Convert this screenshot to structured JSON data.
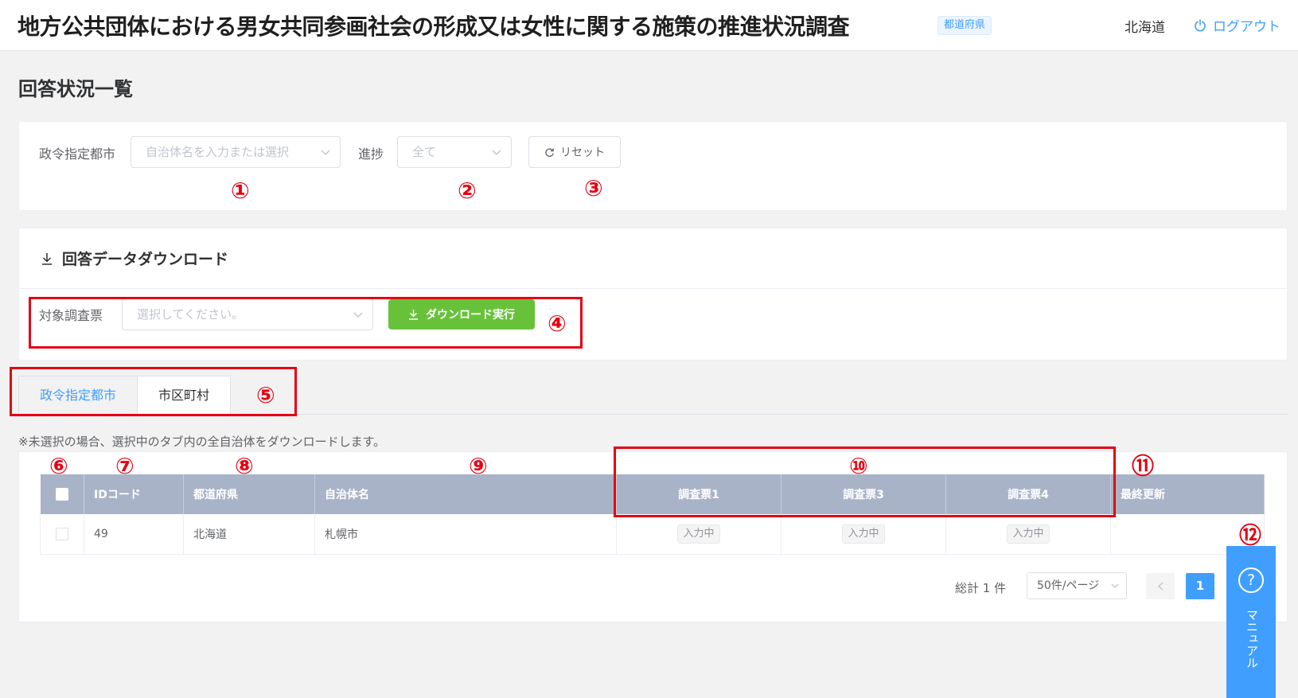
{
  "header": {
    "title": "地方公共団体における男女共同参画社会の形成又は女性に関する施策の推進状況調査",
    "pref_tag": "都道府県",
    "user": "北海道",
    "logout": "ログアウト"
  },
  "page_title": "回答状況一覧",
  "filter": {
    "city_label": "政令指定都市",
    "city_placeholder": "自治体名を入力または選択",
    "progress_label": "進捗",
    "progress_value": "全て",
    "reset": "リセット"
  },
  "download": {
    "title": "回答データダウンロード",
    "target_label": "対象調査票",
    "target_placeholder": "選択してください。",
    "execute": "ダウンロード実行"
  },
  "tabs": [
    "政令指定都市",
    "市区町村"
  ],
  "note": "※未選択の場合、選択中のタブ内の全自治体をダウンロードします。",
  "table": {
    "columns": [
      "IDコード",
      "都道府県",
      "自治体名",
      "調査票1",
      "調査票3",
      "調査票4",
      "最終更新"
    ],
    "rows": [
      {
        "id": "49",
        "pref": "北海道",
        "city": "札幌市",
        "s1": "入力中",
        "s3": "入力中",
        "s4": "入力中",
        "updated": ""
      }
    ]
  },
  "pager": {
    "total": "総計 1 件",
    "size": "50件/ページ",
    "page": "1"
  },
  "manual": {
    "label": "マニュアル",
    "icon": "?"
  },
  "markers": [
    "①",
    "②",
    "③",
    "④",
    "⑤",
    "⑥",
    "⑦",
    "⑧",
    "⑨",
    "⑩",
    "⑪",
    "⑫"
  ],
  "colors": {
    "accent": "#409eff",
    "success": "#67c23a",
    "annotation": "#e60012",
    "table_header": "#a8b3c8"
  }
}
